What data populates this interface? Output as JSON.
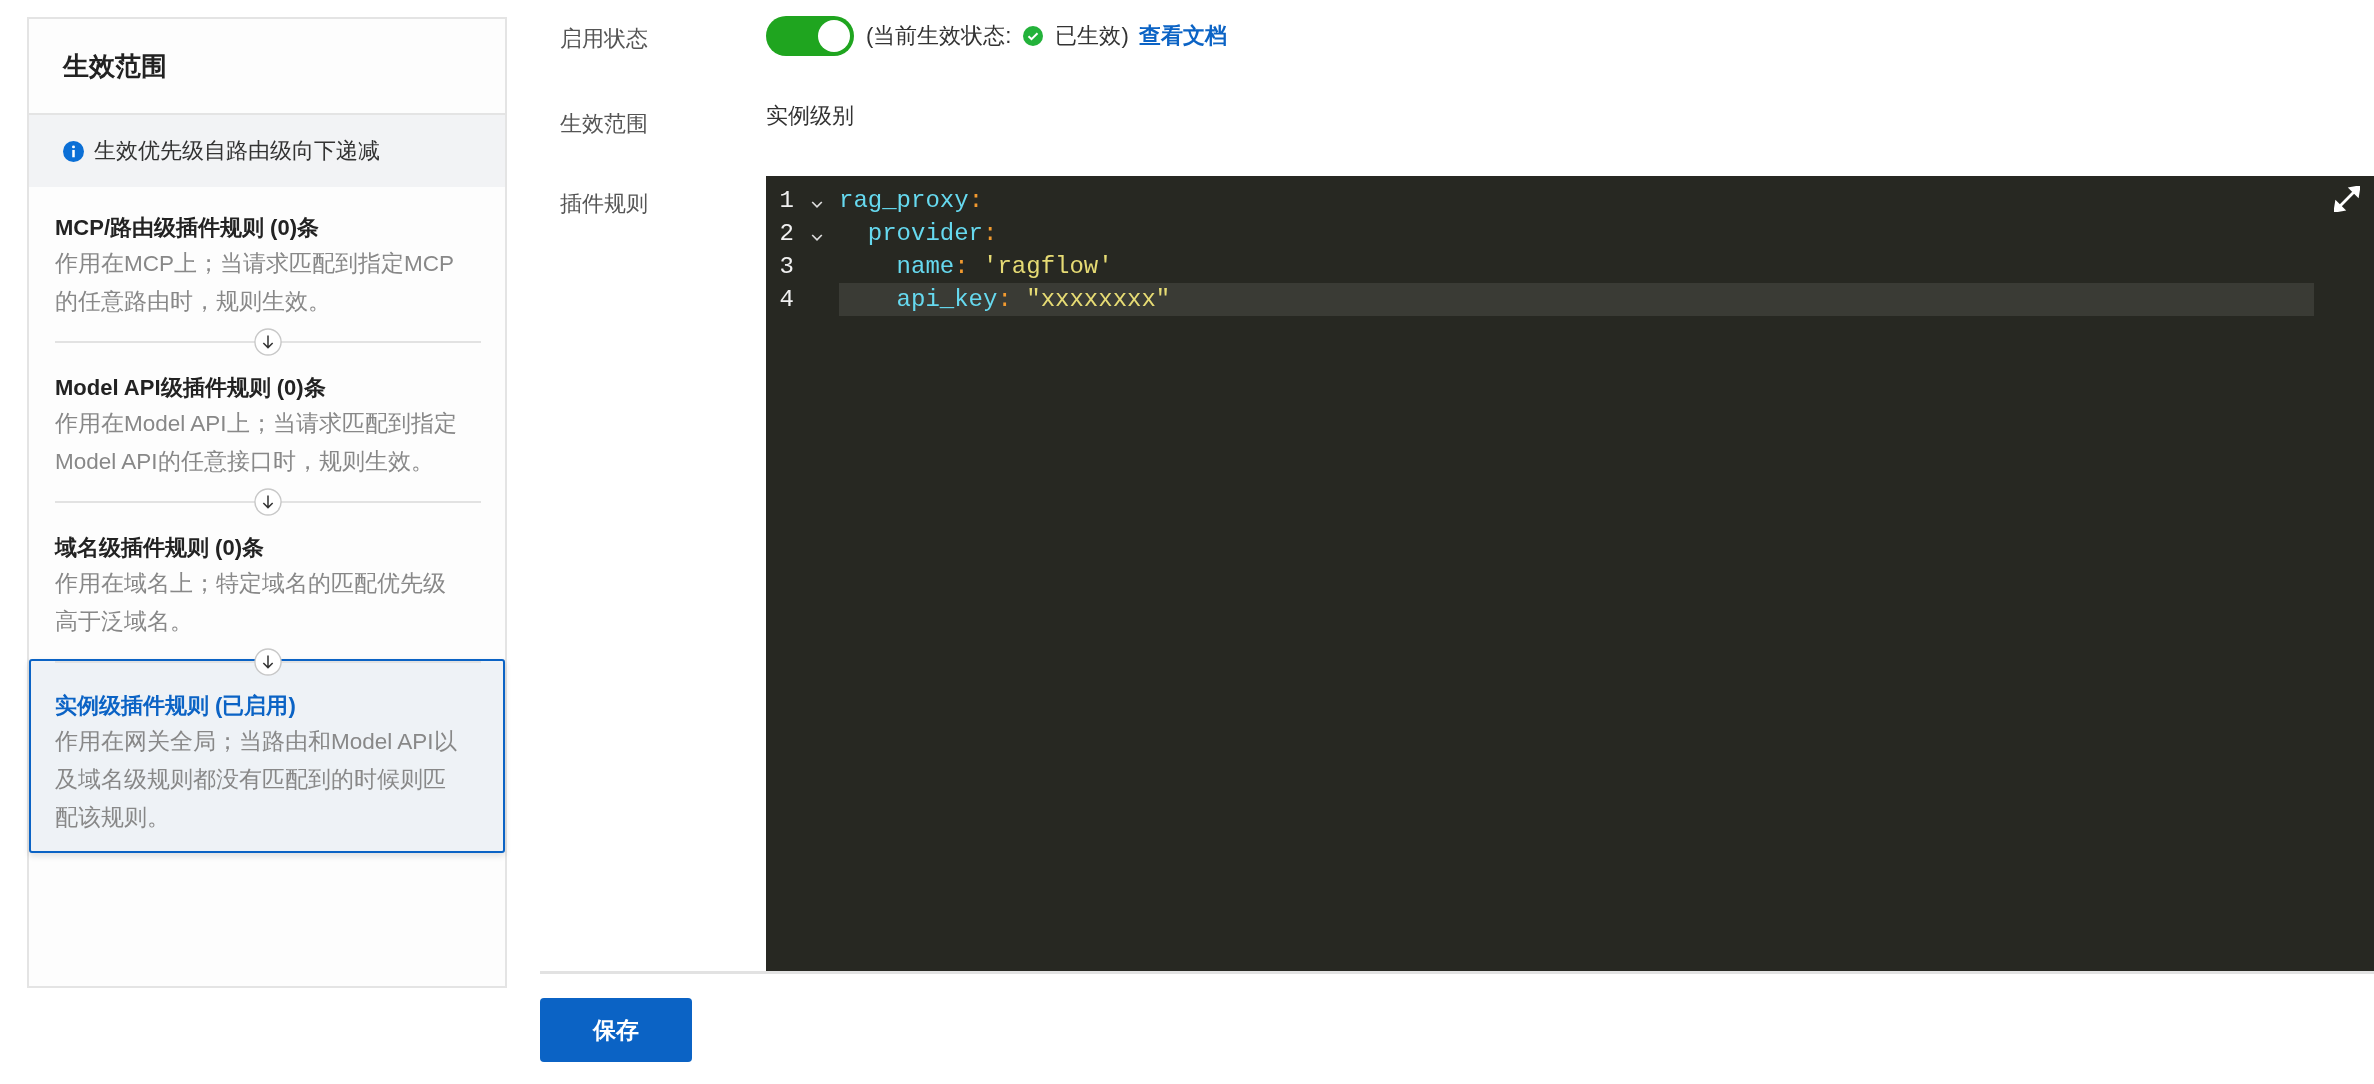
{
  "scope_panel": {
    "title": "生效范围",
    "notice": "生效优先级自路由级向下递减",
    "items": [
      {
        "title": "MCP/路由级插件规则 (0)条",
        "description": "作用在MCP上；当请求匹配到指定MCP的任意路由时，规则生效。",
        "selected": false
      },
      {
        "title": "Model API级插件规则 (0)条",
        "description": "作用在Model API上；当请求匹配到指定Model API的任意接口时，规则生效。",
        "selected": false
      },
      {
        "title": "域名级插件规则 (0)条",
        "description": "作用在域名上；特定域名的匹配优先级高于泛域名。",
        "selected": false
      },
      {
        "title": "实例级插件规则 (已启用)",
        "description": "作用在网关全局；当路由和Model API以及域名级规则都没有匹配到的时候则匹配该规则。",
        "selected": true
      }
    ]
  },
  "form": {
    "enable": {
      "label": "启用状态",
      "on": true,
      "status_prefix": "(当前生效状态:",
      "status_text": "已生效)",
      "link": "查看文档"
    },
    "scope": {
      "label": "生效范围",
      "value": "实例级别"
    },
    "rules": {
      "label": "插件规则",
      "lines": [
        {
          "number": "1",
          "foldable": true,
          "active": false,
          "tokens": [
            {
              "kind": "key",
              "text": "rag_proxy"
            },
            {
              "kind": "punct",
              "text": ":"
            }
          ]
        },
        {
          "number": "2",
          "foldable": true,
          "active": false,
          "tokens": [
            {
              "kind": "key",
              "text": "  provider"
            },
            {
              "kind": "punct",
              "text": ":"
            }
          ]
        },
        {
          "number": "3",
          "foldable": false,
          "active": false,
          "tokens": [
            {
              "kind": "key",
              "text": "    name"
            },
            {
              "kind": "punct",
              "text": ": "
            },
            {
              "kind": "string",
              "text": "'ragflow'"
            }
          ]
        },
        {
          "number": "4",
          "foldable": false,
          "active": true,
          "tokens": [
            {
              "kind": "key",
              "text": "    api_key"
            },
            {
              "kind": "punct",
              "text": ": "
            },
            {
              "kind": "string",
              "text": "\"xxxxxxxx\""
            }
          ]
        }
      ]
    },
    "save_button": "保存"
  }
}
